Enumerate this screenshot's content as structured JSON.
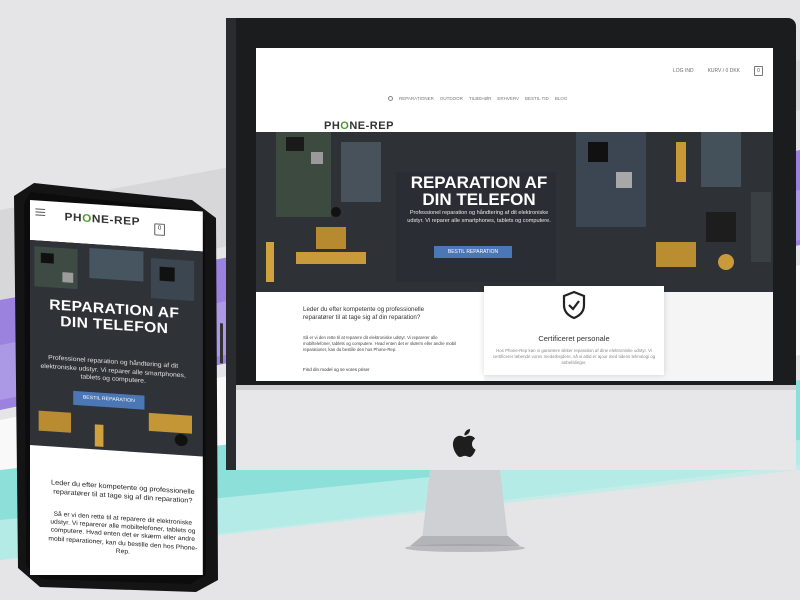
{
  "desktop": {
    "logo": {
      "pre": "PH",
      "o": "O",
      "post": "NE-REP"
    },
    "topbar": {
      "login": "LOG IND",
      "cart": "KURV / 0 DKK",
      "cart_count": "0"
    },
    "nav": [
      "REPARATIONER",
      "OUTDOOR",
      "TILBEHØR",
      "ERHVERV",
      "BESTIL TID",
      "BLOG"
    ],
    "hero": {
      "title": "REPARATION AF DIN TELEFON",
      "text": "Professionel reparation og håndtering af dit elektroniske udstyr. Vi reparer alle smartphones, tablets og computere.",
      "button": "BESTIL REPARATION"
    },
    "intro": {
      "lead": "Leder du efter kompetente og professionelle reparatører til at tage sig af din reparation?",
      "body": "Så er vi den rette til at reparere dit elektroniske udstyr. Vi reparerer alle mobiltelefoner, tablets og computere. Hvad enten det er skærm eller andre mobil reparationer, kan du bestille den hos Phone-Rep.",
      "link": "Find din model og se vores priser"
    },
    "feature": {
      "title": "Certificeret personale",
      "text": "Hos Phone-Rep kan vi garantere sikker reparation af dine elektroniske udstyr. Vi certificerer løbende vores medarbejdere, så vi altid er ajour med tidens teknologi og anbefalinger."
    }
  },
  "mobile": {
    "logo": {
      "pre": "PH",
      "o": "O",
      "post": "NE-REP"
    },
    "cart_count": "0",
    "hero": {
      "title": "REPARATION AF DIN TELEFON",
      "text": "Professionel reparation og håndtering af dit elektroniske udstyr. Vi reparer alle smartphones, tablets og computere.",
      "button": "BESTIL REPARATION"
    },
    "lead": "Leder du efter kompetente og professionelle reparatører til at tage sig af din reparation?",
    "body": "Så er vi den rette til at reparere dit elektroniske udstyr. Vi reparerer alle mobiltelefoner, tablets og computere. Hvad enten det er skærm eller andre mobil reparationer, kan du bestille den hos Phone-Rep."
  },
  "colors": {
    "background": "#e4e4e6",
    "purple_band": "#8b6fd6",
    "teal_band": "#7fdad6",
    "accent_button": "#4c77b6",
    "logo_green": "#4a9d2f",
    "hero_dark": "#2b2f34"
  },
  "icons": [
    "shield-check-icon",
    "apple-logo-icon",
    "cart-icon",
    "menu-icon",
    "search-icon"
  ]
}
